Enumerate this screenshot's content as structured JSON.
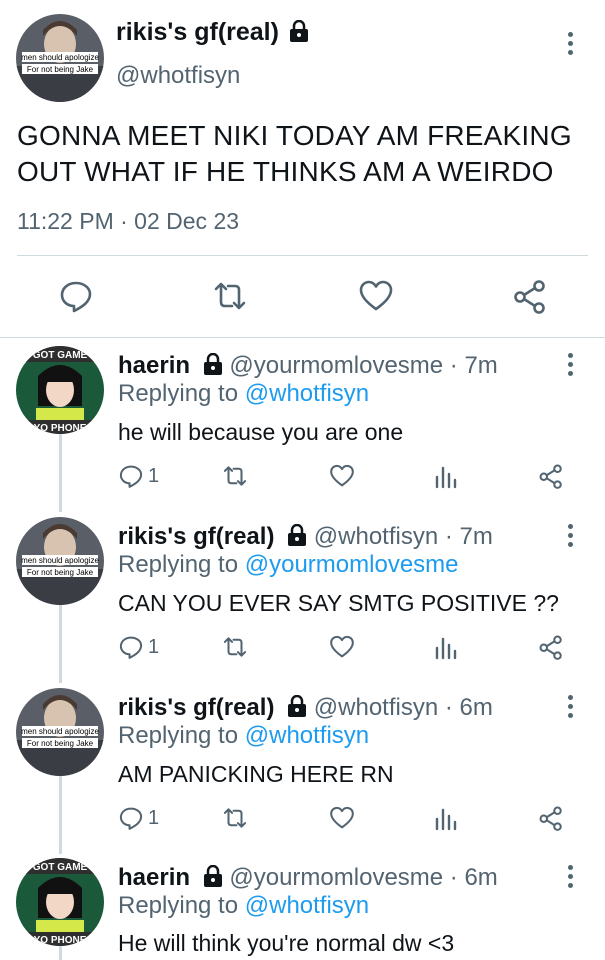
{
  "main_tweet": {
    "avatar_caption_line1": "men should apologize",
    "avatar_caption_line2": "For not being Jake",
    "display_name": "rikis's gf(real)",
    "handle": "@whotfisyn",
    "text": "GONNA MEET NIKI TODAY AM FREAKING OUT WHAT IF HE THINKS AM A WEIRDO",
    "timestamp": "11:22 PM · 02 Dec 23",
    "icons": [
      "comment-icon",
      "retweet-icon",
      "heart-icon",
      "share-icon"
    ]
  },
  "replies": [
    {
      "display_name": "haerin",
      "handle_time": "@yourmomlovesme · 7m",
      "replying_prefix": "Replying to",
      "replying_to": "@whotfisyn",
      "text": "he will because you are one",
      "reply_count": "1",
      "avatar_caption_top": "GOT GAME",
      "avatar_caption_bottom": "YO PHONE"
    },
    {
      "display_name": "rikis's gf(real)",
      "handle_time": "@whotfisyn · 7m",
      "replying_prefix": "Replying to",
      "replying_to": "@yourmomlovesme",
      "text": "CAN YOU EVER SAY SMTG POSITIVE ??",
      "reply_count": "1",
      "avatar_caption_top": "men should apologize",
      "avatar_caption_bottom": "For not being Jake"
    },
    {
      "display_name": "rikis's gf(real)",
      "handle_time": "@whotfisyn · 6m",
      "replying_prefix": "Replying to",
      "replying_to": "@whotfisyn",
      "text": "AM PANICKING HERE RN",
      "reply_count": "1",
      "avatar_caption_top": "men should apologize",
      "avatar_caption_bottom": "For not being Jake"
    },
    {
      "display_name": "haerin",
      "handle_time": "@yourmomlovesme · 6m",
      "replying_prefix": "Replying to",
      "replying_to": "@whotfisyn",
      "text": "He will think you're normal dw <3",
      "avatar_caption_top": "GOT GAME",
      "avatar_caption_bottom": "YO PHONE"
    }
  ],
  "colors": {
    "link": "#1d9bf0",
    "secondary": "#536471",
    "divider": "#cfd9de"
  }
}
